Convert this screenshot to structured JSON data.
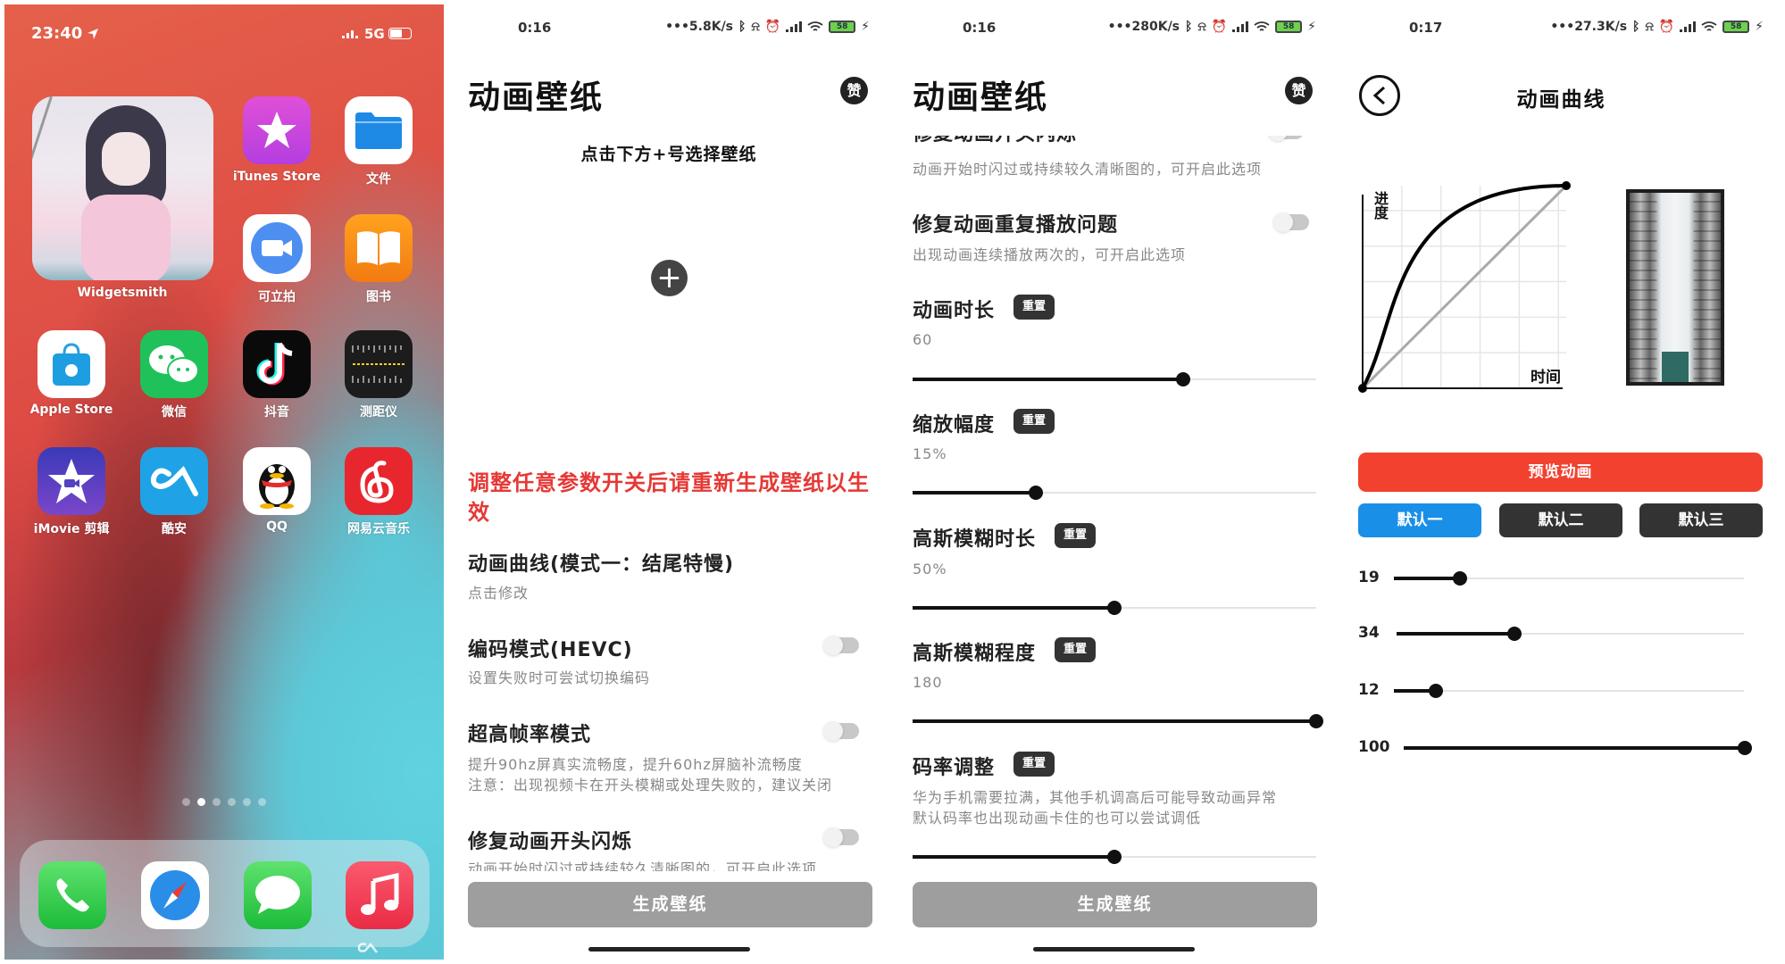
{
  "home": {
    "status": {
      "time": "23:40",
      "network": "5G"
    },
    "widget": {
      "label": "Widgetsmith"
    },
    "apps": [
      {
        "label": "iTunes Store",
        "icon": "star-icon"
      },
      {
        "label": "文件",
        "icon": "folder-icon"
      },
      {
        "label": "可立拍",
        "icon": "video-camera-icon"
      },
      {
        "label": "图书",
        "icon": "book-icon"
      },
      {
        "label": "Apple Store",
        "icon": "shopping-bag-icon"
      },
      {
        "label": "微信",
        "icon": "chat-bubbles-icon"
      },
      {
        "label": "抖音",
        "icon": "music-note-icon"
      },
      {
        "label": "测距仪",
        "icon": "ruler-icon"
      },
      {
        "label": "iMovie 剪辑",
        "icon": "star-camera-icon"
      },
      {
        "label": "酷安",
        "icon": "coolapk-logo-icon"
      },
      {
        "label": "QQ",
        "icon": "penguin-icon"
      },
      {
        "label": "网易云音乐",
        "icon": "netease-music-icon"
      }
    ],
    "dock": [
      "phone-icon",
      "safari-compass-icon",
      "messages-icon",
      "music-icon"
    ],
    "page_dots": {
      "count": 6,
      "active": 1
    }
  },
  "wallpaper_screen": {
    "status": {
      "time": "0:16",
      "speed": "•••5.8K/s",
      "battery": "58"
    },
    "title": "动画壁纸",
    "like_badge": "赞",
    "hint": "点击下方+号选择壁纸",
    "warning": "调整任意参数开关后请重新生成壁纸以生效",
    "curve_item": {
      "title": "动画曲线(模式一：结尾特慢)",
      "desc": "点击修改"
    },
    "toggles": [
      {
        "title": "编码模式(HEVC)",
        "desc": "设置失败时可尝试切换编码",
        "on": false
      },
      {
        "title": "超高帧率模式",
        "desc": "提升90hz屏真实流畅度，提升60hz屏脑补流畅度",
        "desc2": "注意：出现视频卡在开头模糊或处理失败的，建议关闭",
        "on": false
      },
      {
        "title": "修复动画开头闪烁",
        "desc": "动画开始时闪过或持续较久清晰图的，可开启此选项",
        "on": false
      }
    ],
    "generate_label": "生成壁纸"
  },
  "params_screen": {
    "status": {
      "time": "0:16",
      "speed": "•••280K/s",
      "battery": "58"
    },
    "title": "动画壁纸",
    "like_badge": "赞",
    "partial_item": {
      "title": "修复动画开头闪烁",
      "desc": "动画开始时闪过或持续较久清晰图的，可开启此选项",
      "on": false
    },
    "repeat_item": {
      "title": "修复动画重复播放问题",
      "desc": "出现动画连续播放两次的，可开启此选项",
      "on": false
    },
    "reset_label": "重置",
    "sliders": [
      {
        "title": "动画时长",
        "value": "60",
        "fraction": 0.67
      },
      {
        "title": "缩放幅度",
        "value": "15%",
        "fraction": 0.305
      },
      {
        "title": "高斯模糊时长",
        "value": "50%",
        "fraction": 0.5
      },
      {
        "title": "高斯模糊程度",
        "value": "180",
        "fraction": 1.0
      },
      {
        "title": "码率调整",
        "desc": "华为手机需要拉满，其他手机调高后可能导致动画异常",
        "desc2": "默认码率也出现动画卡住的也可以尝试调低",
        "fraction": 0.5
      }
    ],
    "generate_label": "生成壁纸"
  },
  "curve_screen": {
    "status": {
      "time": "0:17",
      "speed": "•••27.3K/s",
      "battery": "58"
    },
    "title": "动画曲线",
    "y_axis_label": "进度",
    "x_axis_label": "时间",
    "preview_label": "预览动画",
    "presets": [
      {
        "label": "默认一",
        "active": true
      },
      {
        "label": "默认二",
        "active": false
      },
      {
        "label": "默认三",
        "active": false
      }
    ],
    "params": [
      {
        "value": "19",
        "fraction": 0.19
      },
      {
        "value": "34",
        "fraction": 0.34
      },
      {
        "value": "12",
        "fraction": 0.12
      },
      {
        "value": "100",
        "fraction": 1.0
      }
    ],
    "colors": {
      "preview": "#f2412f",
      "preset_active": "#1a8fe8",
      "preset_inactive": "#333333"
    }
  }
}
